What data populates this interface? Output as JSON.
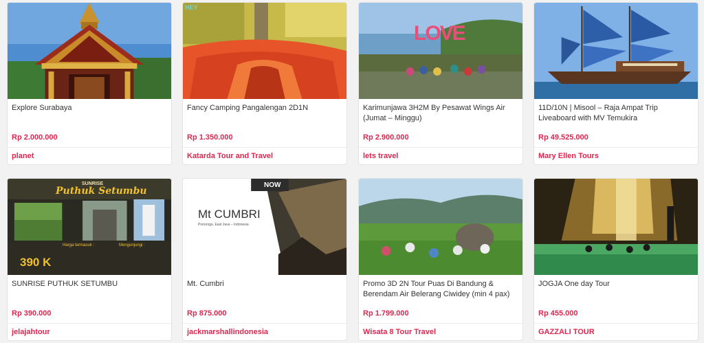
{
  "cards": [
    {
      "title": "Explore Surabaya",
      "price": "Rp 2.000.000",
      "vendor": "planet"
    },
    {
      "title": "Fancy Camping Pangalengan 2D1N",
      "price": "Rp 1.350.000",
      "vendor": "Katarda Tour and Travel",
      "image_text": "HEY"
    },
    {
      "title": "Karimunjawa 3H2M By Pesawat Wings Air (Jumat – Minggu)",
      "price": "Rp 2.900.000",
      "vendor": "lets travel",
      "image_text": "LOVE"
    },
    {
      "title": "11D/10N | Misool – Raja Ampat Trip Liveaboard with MV Temukira",
      "price": "Rp 49.525.000",
      "vendor": "Mary Ellen Tours"
    },
    {
      "title": "SUNRISE PUTHUK SETUMBU",
      "price": "Rp 390.000",
      "vendor": "jelajahtour",
      "image_text": {
        "top": "SUNRISE",
        "script": "Puthuk Setumbu",
        "price": "390 K",
        "left_head": "Harga termasuk :",
        "right_head": "Mengunjungi :"
      }
    },
    {
      "title": "Mt. Cumbri",
      "price": "Rp 875.000",
      "vendor": "jackmarshallindonesia",
      "image_text": {
        "badge": "NOW",
        "heading": "Mt CUMBRI",
        "sub": "Ponorogo, East Java – Indonesia"
      }
    },
    {
      "title": "Promo 3D 2N Tour Puas Di Bandung & Berendam Air Belerang Ciwidey (min 4 pax)",
      "price": "Rp 1.799.000",
      "vendor": "Wisata 8 Tour Travel"
    },
    {
      "title": "JOGJA One day Tour",
      "price": "Rp 455.000",
      "vendor": "GAZZALI TOUR"
    }
  ],
  "colors": {
    "accent": "#e0254f",
    "text": "#333333",
    "background": "#f2f2f2"
  }
}
